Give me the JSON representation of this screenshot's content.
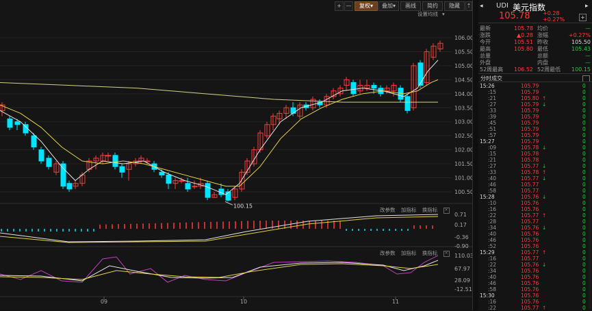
{
  "toolbar": {
    "plus": "+",
    "minus": "—",
    "double_up": "⇡",
    "buttons": [
      "复权",
      "叠加",
      "画线",
      "简约",
      "隐藏"
    ],
    "ma_settings": "设置均线"
  },
  "price_axis": [
    "106.00",
    "105.50",
    "105.00",
    "104.50",
    "104.00",
    "103.50",
    "103.00",
    "102.50",
    "102.00",
    "101.50",
    "101.00",
    "100.50"
  ],
  "low_marker": "100.15",
  "indicator_menu": [
    "改参数",
    "加指标",
    "换指标"
  ],
  "macd_axis": [
    "0.71",
    "0.17",
    "-0.36",
    "-0.90"
  ],
  "kdj_axis": [
    "110.03",
    "67.97",
    "28.09",
    "-12.51"
  ],
  "date_labels": [
    "09",
    "10",
    "11"
  ],
  "quote": {
    "code": "UDI",
    "name": "美元指数",
    "price": "105.78",
    "change": "+0.28",
    "change_pct": "+0.27%",
    "rows": [
      {
        "l1": "最新",
        "v1": "105.78",
        "c1": "red",
        "l2": "均价",
        "v2": "—",
        "c2": "green"
      },
      {
        "l1": "涨跌",
        "v1": "▲0.28",
        "c1": "red",
        "l2": "涨幅",
        "v2": "+0.27%",
        "c2": "red"
      },
      {
        "l1": "今开",
        "v1": "105.51",
        "c1": "red",
        "l2": "昨收",
        "v2": "105.50",
        "c2": "white"
      },
      {
        "l1": "最高",
        "v1": "105.80",
        "c1": "red",
        "l2": "最低",
        "v2": "105.43",
        "c2": "green"
      },
      {
        "l1": "总量",
        "v1": "",
        "c1": "white",
        "l2": "总额",
        "v2": "—",
        "c2": "green"
      },
      {
        "l1": "外盘",
        "v1": "",
        "c1": "white",
        "l2": "内盘",
        "v2": "—",
        "c2": "green"
      },
      {
        "l1": "52周最高",
        "v1": "106.52",
        "c1": "red",
        "l2": "52周最低",
        "v2": "100.15",
        "c2": "green"
      }
    ],
    "trades_title": "分时成交",
    "trades": [
      {
        "t": "15:26",
        "p": "105.79",
        "c": "red",
        "a": "",
        "v": "0",
        "h": true
      },
      {
        "t": ":15",
        "p": "105.79",
        "c": "red",
        "a": "",
        "v": "0"
      },
      {
        "t": ":21",
        "p": "105.80",
        "c": "red",
        "a": "↑",
        "v": "0"
      },
      {
        "t": ":27",
        "p": "105.79",
        "c": "red",
        "a": "↓",
        "v": "0"
      },
      {
        "t": ":33",
        "p": "105.79",
        "c": "red",
        "a": "",
        "v": "0"
      },
      {
        "t": ":39",
        "p": "105.79",
        "c": "red",
        "a": "",
        "v": "0"
      },
      {
        "t": ":45",
        "p": "105.79",
        "c": "red",
        "a": "",
        "v": "0"
      },
      {
        "t": ":51",
        "p": "105.79",
        "c": "red",
        "a": "",
        "v": "0"
      },
      {
        "t": ":57",
        "p": "105.79",
        "c": "red",
        "a": "",
        "v": "0"
      },
      {
        "t": "15:27",
        "p": "105.79",
        "c": "red",
        "a": "",
        "v": "0",
        "h": true
      },
      {
        "t": ":09",
        "p": "105.78",
        "c": "red",
        "a": "↓",
        "v": "0"
      },
      {
        "t": ":15",
        "p": "105.78",
        "c": "red",
        "a": "",
        "v": "0"
      },
      {
        "t": ":21",
        "p": "105.78",
        "c": "red",
        "a": "",
        "v": "0"
      },
      {
        "t": ":27",
        "p": "105.77",
        "c": "red",
        "a": "↓",
        "v": "0"
      },
      {
        "t": ":33",
        "p": "105.78",
        "c": "red",
        "a": "↑",
        "v": "0"
      },
      {
        "t": ":40",
        "p": "105.77",
        "c": "red",
        "a": "↓",
        "v": "0"
      },
      {
        "t": ":46",
        "p": "105.77",
        "c": "red",
        "a": "",
        "v": "0"
      },
      {
        "t": ":58",
        "p": "105.77",
        "c": "red",
        "a": "",
        "v": "0"
      },
      {
        "t": "15:28",
        "p": "105.76",
        "c": "red",
        "a": "↓",
        "v": "0",
        "h": true
      },
      {
        "t": ":10",
        "p": "105.76",
        "c": "red",
        "a": "",
        "v": "0"
      },
      {
        "t": ":16",
        "p": "105.76",
        "c": "red",
        "a": "",
        "v": "0"
      },
      {
        "t": ":22",
        "p": "105.77",
        "c": "red",
        "a": "↑",
        "v": "0"
      },
      {
        "t": ":28",
        "p": "105.77",
        "c": "red",
        "a": "",
        "v": "0"
      },
      {
        "t": ":34",
        "p": "105.76",
        "c": "red",
        "a": "↓",
        "v": "0"
      },
      {
        "t": ":40",
        "p": "105.76",
        "c": "red",
        "a": "",
        "v": "0"
      },
      {
        "t": ":46",
        "p": "105.76",
        "c": "red",
        "a": "",
        "v": "0"
      },
      {
        "t": ":52",
        "p": "105.76",
        "c": "red",
        "a": "",
        "v": "0"
      },
      {
        "t": "15:29",
        "p": "105.77",
        "c": "red",
        "a": "↑",
        "v": "0",
        "h": true
      },
      {
        "t": ":16",
        "p": "105.77",
        "c": "red",
        "a": "",
        "v": "0"
      },
      {
        "t": ":22",
        "p": "105.76",
        "c": "red",
        "a": "↓",
        "v": "0"
      },
      {
        "t": ":34",
        "p": "105.76",
        "c": "red",
        "a": "",
        "v": "0"
      },
      {
        "t": ":40",
        "p": "105.76",
        "c": "red",
        "a": "",
        "v": "0"
      },
      {
        "t": ":46",
        "p": "105.76",
        "c": "red",
        "a": "",
        "v": "0"
      },
      {
        "t": ":58",
        "p": "105.76",
        "c": "red",
        "a": "",
        "v": "0"
      },
      {
        "t": "15:30",
        "p": "105.76",
        "c": "red",
        "a": "",
        "v": "0",
        "h": true
      },
      {
        "t": ":16",
        "p": "105.76",
        "c": "red",
        "a": "",
        "v": "0"
      },
      {
        "t": ":22",
        "p": "105.77",
        "c": "red",
        "a": "↑",
        "v": "0"
      }
    ]
  },
  "colors": {
    "up": "#ff3b3b",
    "down": "#00e5ff",
    "ma5": "#e6e6e6",
    "ma10": "#e6d34a",
    "ma60": "#d6d28a",
    "kdj_j": "#c040c0"
  }
}
